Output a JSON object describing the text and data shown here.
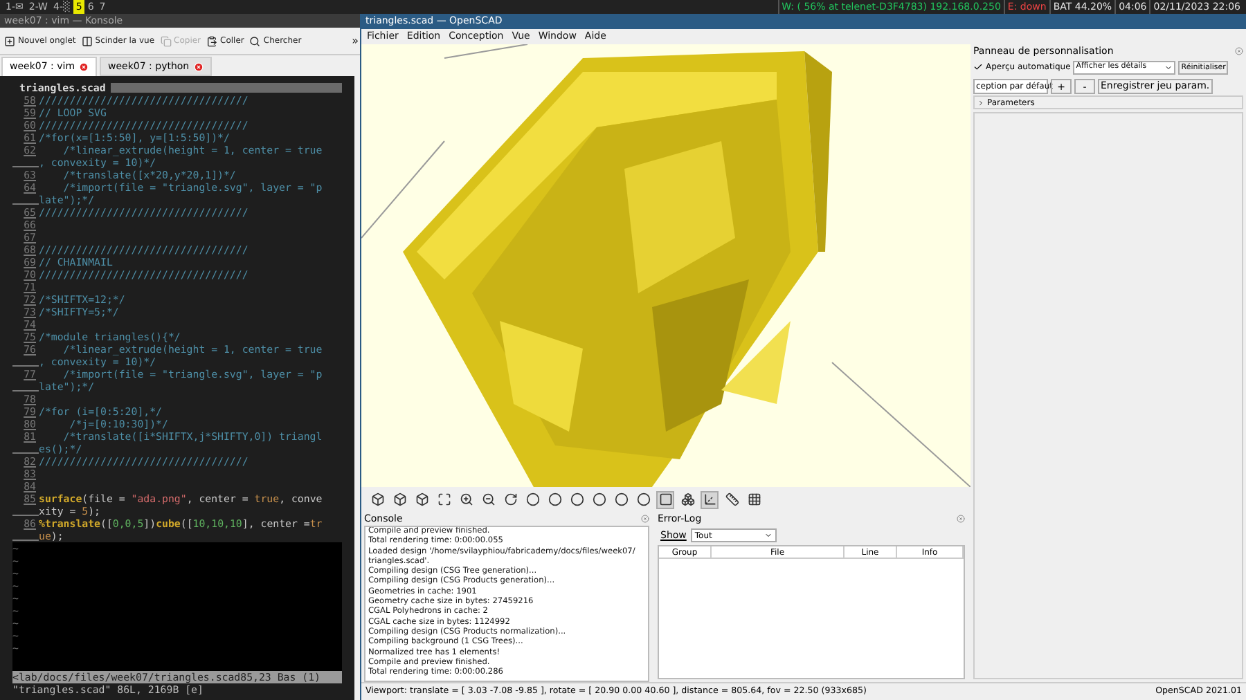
{
  "top_bar": {
    "workspaces": [
      {
        "label": "1-✉",
        "selected": false
      },
      {
        "label": "2-W",
        "selected": false
      },
      {
        "label": "4-░",
        "selected": false
      },
      {
        "label": "5",
        "selected": true
      },
      {
        "label": "6",
        "selected": false
      },
      {
        "label": "7",
        "selected": false
      }
    ],
    "status": [
      {
        "text": "W: ( 56% at telenet-D3F4783) 192.168.0.250",
        "kind": "up"
      },
      {
        "text": "E: down",
        "kind": "down"
      },
      {
        "text": "BAT 44.20%",
        "kind": "plain"
      },
      {
        "text": "04:06",
        "kind": "plain"
      },
      {
        "text": "02/11/2023 22:06",
        "kind": "plain"
      }
    ]
  },
  "konsole": {
    "title": "week07 : vim — Konsole",
    "toolbar": [
      {
        "label": "Nouvel onglet",
        "disabled": false
      },
      {
        "label": "Scinder la vue",
        "disabled": false
      },
      {
        "label": "Copier",
        "disabled": true
      },
      {
        "label": "Coller",
        "disabled": false
      },
      {
        "label": "Chercher",
        "disabled": false
      }
    ],
    "overflow": "»",
    "tabs": [
      {
        "label": "week07 : vim",
        "selected": true
      },
      {
        "label": "week07 : python",
        "selected": false
      }
    ],
    "vim": {
      "file_tab": "triangles.scad",
      "lines": [
        {
          "number": "58",
          "tokens": [
            {
              "text": "//////////////////////////////////",
              "kind": "comment"
            }
          ]
        },
        {
          "number": "59",
          "tokens": [
            {
              "text": "// LOOP SVG",
              "kind": "comment"
            }
          ]
        },
        {
          "number": "60",
          "tokens": [
            {
              "text": "//////////////////////////////////",
              "kind": "comment"
            }
          ]
        },
        {
          "number": "61",
          "tokens": [
            {
              "text": "/*for(x=[1:5:50], y=[1:5:50])*/",
              "kind": "comment"
            }
          ]
        },
        {
          "number": "62",
          "tokens": [
            {
              "text": "    /*linear_extrude(height = 1, center = true",
              "kind": "comment"
            }
          ],
          "wrap": [
            {
              "text": ", convexity = 10)*/",
              "kind": "comment"
            }
          ]
        },
        {
          "number": "63",
          "tokens": [
            {
              "text": "    /*translate([x*20,y*20,1])*/",
              "kind": "comment"
            }
          ]
        },
        {
          "number": "64",
          "tokens": [
            {
              "text": "    /*import(file = \"triangle.svg\", layer = \"p",
              "kind": "comment"
            }
          ],
          "wrap": [
            {
              "text": "late\");*/",
              "kind": "comment"
            }
          ]
        },
        {
          "number": "65",
          "tokens": [
            {
              "text": "//////////////////////////////////",
              "kind": "comment"
            }
          ]
        },
        {
          "number": "66"
        },
        {
          "number": "67"
        },
        {
          "number": "68",
          "tokens": [
            {
              "text": "//////////////////////////////////",
              "kind": "comment"
            }
          ]
        },
        {
          "number": "69",
          "tokens": [
            {
              "text": "// CHAINMAIL",
              "kind": "comment"
            }
          ]
        },
        {
          "number": "70",
          "tokens": [
            {
              "text": "//////////////////////////////////",
              "kind": "comment"
            }
          ]
        },
        {
          "number": "71"
        },
        {
          "number": "72",
          "tokens": [
            {
              "text": "/*SHIFTX=12;*/",
              "kind": "comment"
            }
          ]
        },
        {
          "number": "73",
          "tokens": [
            {
              "text": "/*SHIFTY=5;*/",
              "kind": "comment"
            }
          ]
        },
        {
          "number": "74"
        },
        {
          "number": "75",
          "tokens": [
            {
              "text": "/*module triangles(){*/",
              "kind": "comment"
            }
          ]
        },
        {
          "number": "76",
          "tokens": [
            {
              "text": "    /*linear_extrude(height = 1, center = true",
              "kind": "comment"
            }
          ],
          "wrap": [
            {
              "text": ", convexity = 10)*/",
              "kind": "comment"
            }
          ]
        },
        {
          "number": "77",
          "tokens": [
            {
              "text": "    /*import(file = \"triangle.svg\", layer = \"p",
              "kind": "comment"
            }
          ],
          "wrap": [
            {
              "text": "late\");*/",
              "kind": "comment"
            }
          ]
        },
        {
          "number": "78"
        },
        {
          "number": "79",
          "tokens": [
            {
              "text": "/*for (i=[0:5:20],*/",
              "kind": "comment"
            }
          ]
        },
        {
          "number": "80",
          "tokens": [
            {
              "text": "     /*j=[0:10:30])*/",
              "kind": "comment"
            }
          ]
        },
        {
          "number": "81",
          "tokens": [
            {
              "text": "    /*translate([i*SHIFTX,j*SHIFTY,0]) triangl",
              "kind": "comment"
            }
          ],
          "wrap": [
            {
              "text": "es();*/",
              "kind": "comment"
            }
          ]
        },
        {
          "number": "82",
          "tokens": [
            {
              "text": "//////////////////////////////////",
              "kind": "comment"
            }
          ]
        },
        {
          "number": "83"
        },
        {
          "number": "84"
        },
        {
          "number": "85",
          "tokens": [
            {
              "text": "surface",
              "kind": "keyword"
            },
            {
              "text": "(file = ",
              "kind": "plain"
            },
            {
              "text": "\"ada.png\"",
              "kind": "string"
            },
            {
              "text": ", center = ",
              "kind": "plain"
            },
            {
              "text": "true",
              "kind": "constant"
            },
            {
              "text": ", conve",
              "kind": "plain"
            }
          ],
          "wrap": [
            {
              "text": "xity = ",
              "kind": "plain"
            },
            {
              "text": "5",
              "kind": "constant"
            },
            {
              "text": ");",
              "kind": "plain"
            }
          ]
        },
        {
          "number": "86",
          "tokens": [
            {
              "text": "%translate",
              "kind": "keyword"
            },
            {
              "text": "([",
              "kind": "plain"
            },
            {
              "text": "0,0,5",
              "kind": "number"
            },
            {
              "text": "])",
              "kind": "plain"
            },
            {
              "text": "cube",
              "kind": "keyword"
            },
            {
              "text": "([",
              "kind": "plain"
            },
            {
              "text": "10,10,10",
              "kind": "number"
            },
            {
              "text": "], center =",
              "kind": "plain"
            },
            {
              "text": "tr",
              "kind": "constant"
            }
          ],
          "wrap": [
            {
              "text": "ue",
              "kind": "constant"
            },
            {
              "text": ");",
              "kind": "plain"
            }
          ]
        }
      ],
      "tildes": [
        "~",
        "~",
        "~",
        "~",
        "~",
        "~",
        "~",
        "~",
        "~"
      ],
      "status_line": "<lab/docs/files/week07/triangles.scad85,23 Bas (1)",
      "message": "\"triangles.scad\" 86L, 2169B [e]"
    }
  },
  "openscad": {
    "title": "triangles.scad — OpenSCAD",
    "menu": [
      "Fichier",
      "Edition",
      "Conception",
      "Vue",
      "Window",
      "Aide"
    ],
    "toolbar_active": [
      false,
      false,
      false,
      false,
      false,
      false,
      false,
      false,
      false,
      false,
      false,
      false,
      false,
      true,
      false,
      true,
      false,
      false
    ],
    "console": {
      "title": "Console",
      "lines": [
        "Compile and preview finished.",
        "Total rendering time: 0:00:00.055",
        "Loaded design '/home/svilayphiou/fabricademy/docs/files/week07/",
        "triangles.scad'.",
        "Compiling design (CSG Tree generation)...",
        "Compiling design (CSG Products generation)...",
        "Geometries in cache: 1901",
        "Geometry cache size in bytes: 27459216",
        "CGAL Polyhedrons in cache: 2",
        "CGAL cache size in bytes: 1124992",
        "Compiling design (CSG Products normalization)...",
        "Compiling background (1 CSG Trees)...",
        "Normalized tree has 1 elements!",
        "Compile and preview finished.",
        "Total rendering time: 0:00:00.286"
      ]
    },
    "error_log": {
      "title": "Error-Log",
      "show_label": "Show",
      "show_value": "Tout",
      "columns": [
        "Group",
        "File",
        "Line",
        "Info"
      ]
    },
    "customizer": {
      "title": "Panneau de personnalisation",
      "auto_preview": {
        "label": "Aperçu automatique",
        "checked": true
      },
      "details": "Afficher les détails",
      "reset": "Réinitialiser",
      "preset": "ception par défaut",
      "plus": "+",
      "minus": "-",
      "save": "Enregistrer jeu param.",
      "section": {
        "label": "Parameters",
        "expanded": false
      }
    },
    "status_bar": {
      "viewport": "Viewport: translate = [ 3.03 -7.08 -9.85 ], rotate = [ 20.90 0.00 40.60 ], distance = 805.64, fov = 22.50 (933x685)",
      "version": "OpenSCAD 2021.01"
    }
  }
}
